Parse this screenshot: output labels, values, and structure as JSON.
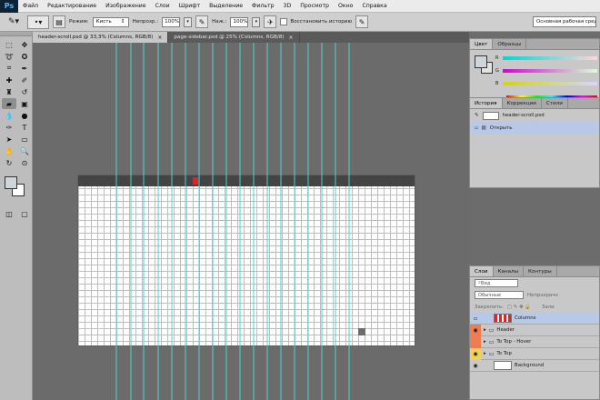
{
  "app": {
    "logo": "Ps"
  },
  "menu": [
    "Файл",
    "Редактирование",
    "Изображение",
    "Слои",
    "Шрифт",
    "Выделение",
    "Фильтр",
    "3D",
    "Просмотр",
    "Окно",
    "Справка"
  ],
  "options": {
    "mode_label": "Режим:",
    "mode_value": "Кисть",
    "opacity_label": "Непрозр.:",
    "opacity_value": "100%",
    "pressure_label": "Наж.:",
    "pressure_value": "100%",
    "restore_history": "Восстановить историю",
    "workspace": "Основная рабочая сред"
  },
  "tabs": [
    {
      "label": "header-scroll.psd @ 33,3% (Columns, RGB/8)",
      "close": "×"
    },
    {
      "label": "page-sidebar.psd @ 25% (Columns, RGB/8)",
      "close": "×"
    }
  ],
  "color_panel": {
    "tabs": [
      "Цвет",
      "Образцы"
    ],
    "r": "R",
    "g": "G",
    "b": "B"
  },
  "history_panel": {
    "tabs": [
      "История",
      "Коррекции",
      "Стили"
    ],
    "rows": [
      "header-scroll.psd",
      "Открыть"
    ]
  },
  "layers_panel": {
    "tabs": [
      "Слои",
      "Каналы",
      "Контуры"
    ],
    "kind": "Вид",
    "blend": "Обычные",
    "opacity_label": "Непрозрачн",
    "lock_label": "Закрепить:",
    "fill_label": "Зали",
    "layers": [
      {
        "name": "Columns",
        "type": "layer"
      },
      {
        "name": "Header",
        "type": "group"
      },
      {
        "name": "To Top - Hover",
        "type": "group"
      },
      {
        "name": "To Top",
        "type": "group"
      },
      {
        "name": "Background",
        "type": "layer"
      }
    ]
  },
  "doc_header": {
    "items": [
      "",
      "",
      "",
      "",
      ""
    ],
    "active": ""
  }
}
